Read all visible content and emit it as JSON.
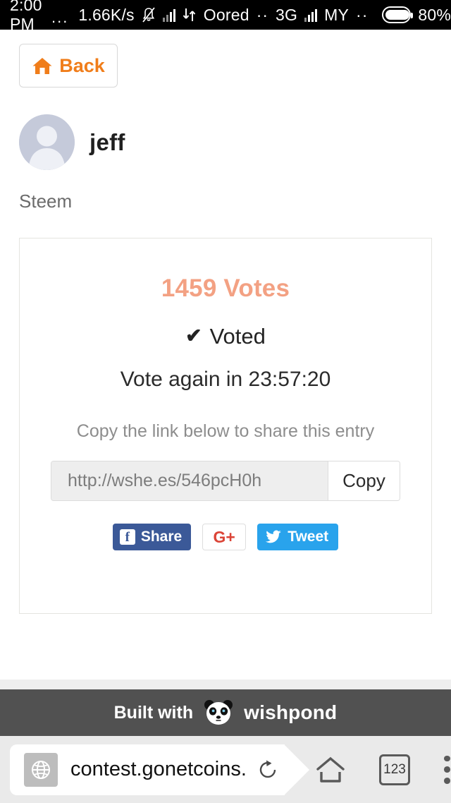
{
  "status_bar": {
    "clock": "2:00 PM",
    "overflow_dots": "...",
    "data_rate": "1.66K/s",
    "mute_icon": "bell-muted-icon",
    "signal1_icon": "signal-bars-icon",
    "data_transfer_icon": "data-transfer-icon",
    "carrier": "Oored",
    "carrier_dots": "··",
    "network_type": "3G",
    "signal2_icon": "signal-bars-icon",
    "sim2_label": "MY",
    "sim2_dots": "··",
    "battery_icon": "battery-icon",
    "battery_percent": "80%"
  },
  "page": {
    "back_button": {
      "label": "Back",
      "icon": "home-icon",
      "icon_color": "#f07d1a"
    },
    "profile": {
      "avatar_icon": "user-avatar-icon",
      "username": "jeff"
    },
    "subtitle": "Steem",
    "card": {
      "votes_text": "1459 Votes",
      "votes_color": "#f3a183",
      "voted_check": "✔",
      "voted_label": "Voted",
      "vote_again": "Vote again in 23:57:20",
      "copy_hint": "Copy the link below to share this entry",
      "share_url": "http://wshe.es/546pcH0h",
      "share_url_placeholder": "http://wshe.es/546pcH0h",
      "copy_button": "Copy",
      "socials": [
        {
          "name": "facebook",
          "glyph": "f",
          "label": "Share",
          "color": "#3b5998"
        },
        {
          "name": "googleplus",
          "glyph": "G+",
          "label": "",
          "color": "#db4437"
        },
        {
          "name": "twitter",
          "glyph": "twitter-bird-icon",
          "label": "Tweet",
          "color": "#29a3ec"
        }
      ]
    }
  },
  "footer": {
    "built_with": "Built with",
    "logo_icon": "panda-logo-icon",
    "brand": "wishpond",
    "background": "#515151"
  },
  "browser_bar": {
    "site_icon": "globe-icon",
    "url": "contest.gonetcoins.",
    "reload_icon": "reload-icon",
    "home_icon": "home-outline-icon",
    "tab_count": "123",
    "menu_icon": "kebab-menu-icon"
  }
}
